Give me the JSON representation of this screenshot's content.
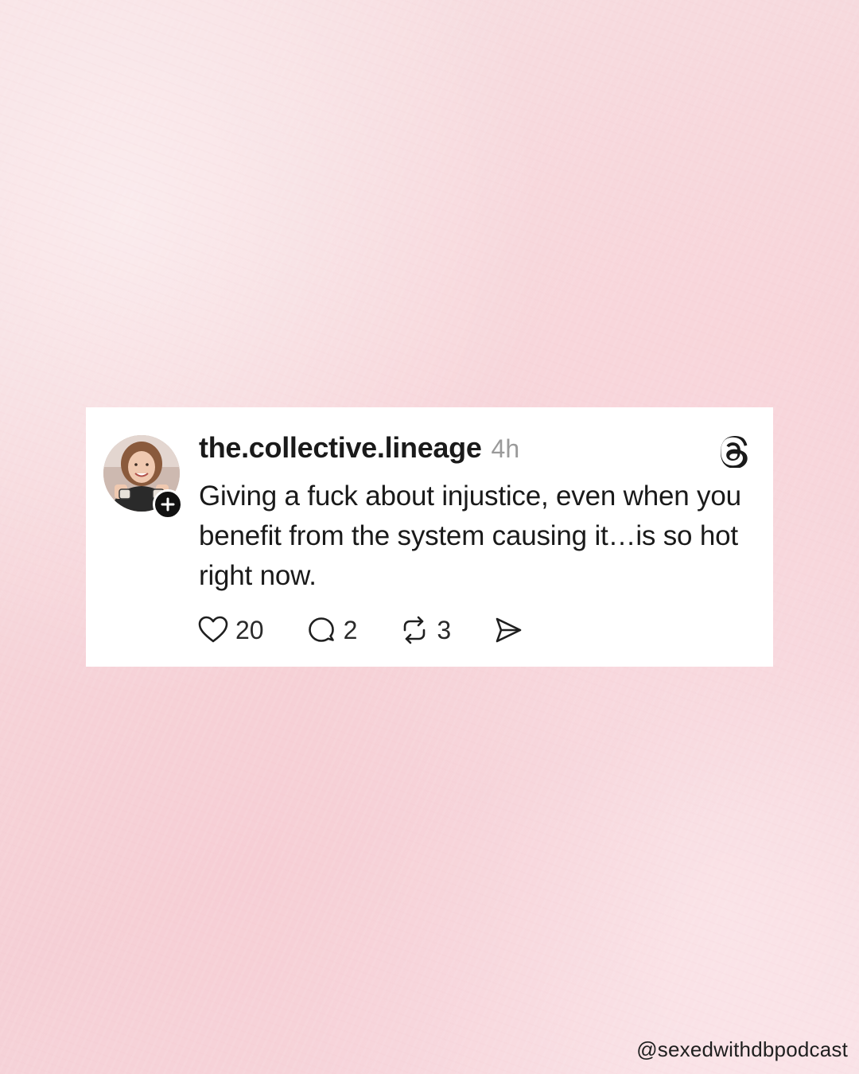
{
  "background": {
    "color": "#f6d6da"
  },
  "post": {
    "username": "the.collective.lineage",
    "timestamp": "4h",
    "text": "Giving a fuck about injustice, even when you benefit from the system causing it…is so hot right now.",
    "avatar_icon": "profile-photo",
    "follow_icon": "plus-icon",
    "brand_icon": "threads-logo-icon",
    "actions": {
      "like": {
        "icon": "heart-icon",
        "count": "20"
      },
      "comment": {
        "icon": "comment-bubble-icon",
        "count": "2"
      },
      "repost": {
        "icon": "repost-icon",
        "count": "3"
      },
      "share": {
        "icon": "send-icon"
      }
    }
  },
  "watermark": "@sexedwithdbpodcast"
}
